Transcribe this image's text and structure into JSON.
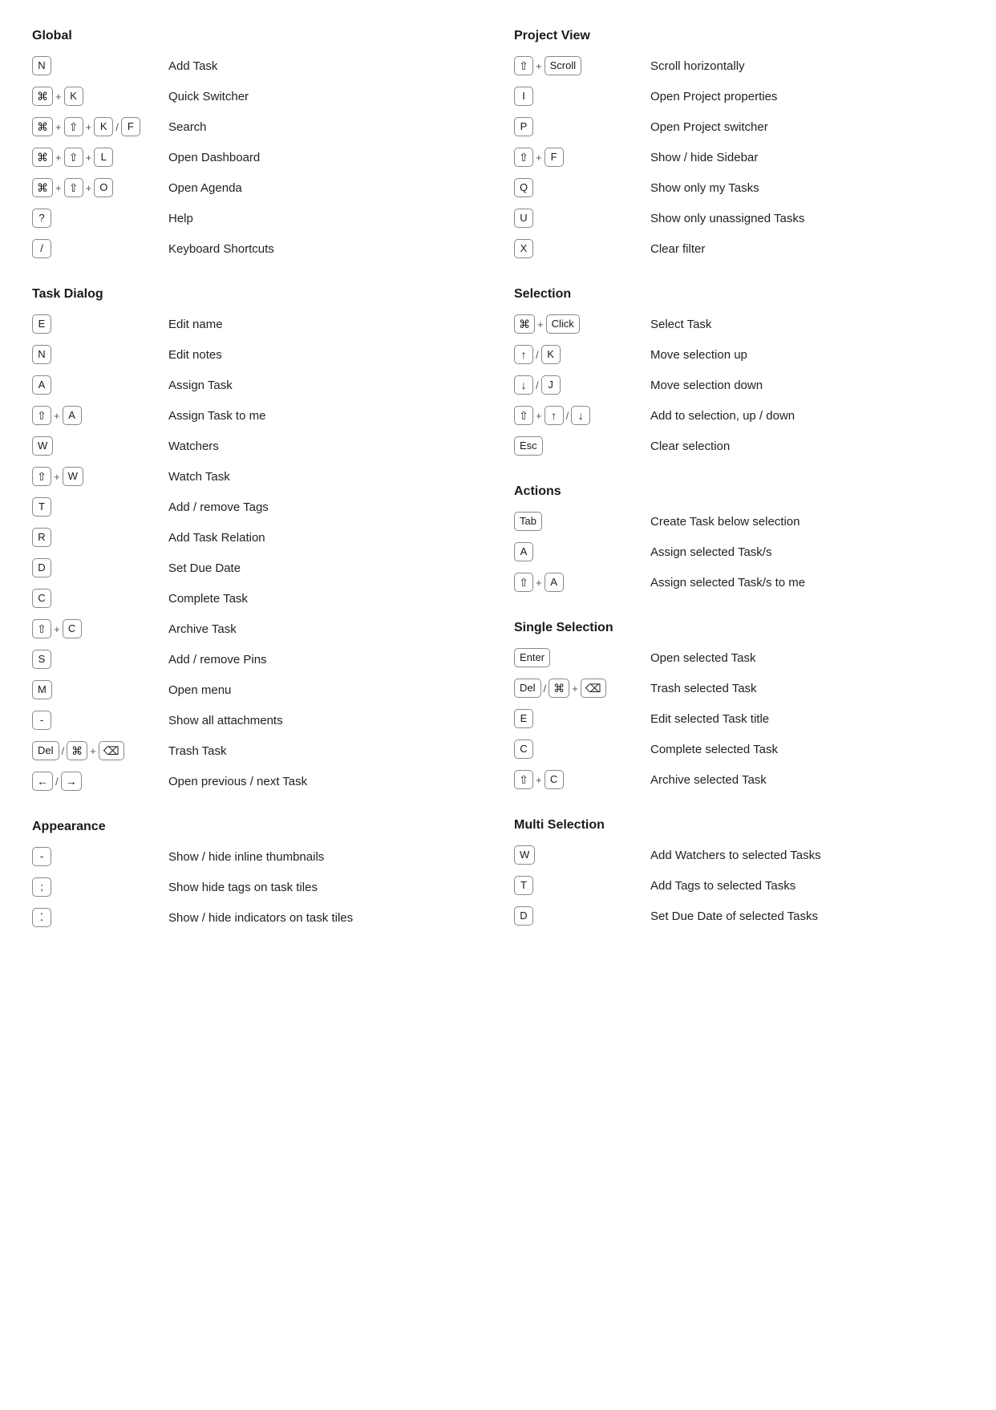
{
  "sections": {
    "global": {
      "title": "Global",
      "shortcuts": [
        {
          "keys": [
            {
              "k": "N",
              "type": "key"
            }
          ],
          "desc": "Add Task"
        },
        {
          "keys": [
            {
              "k": "⌘",
              "type": "key-sym"
            },
            {
              "k": "+",
              "type": "sep"
            },
            {
              "k": "K",
              "type": "key"
            }
          ],
          "desc": "Quick Switcher"
        },
        {
          "keys": [
            {
              "k": "⌘",
              "type": "key-sym"
            },
            {
              "k": "+",
              "type": "sep"
            },
            {
              "k": "⇧",
              "type": "key-sym"
            },
            {
              "k": "+",
              "type": "sep"
            },
            {
              "k": "K",
              "type": "key"
            },
            {
              "k": "/",
              "type": "sep"
            },
            {
              "k": "F",
              "type": "key"
            }
          ],
          "desc": "Search"
        },
        {
          "keys": [
            {
              "k": "⌘",
              "type": "key-sym"
            },
            {
              "k": "+",
              "type": "sep"
            },
            {
              "k": "⇧",
              "type": "key-sym"
            },
            {
              "k": "+",
              "type": "sep"
            },
            {
              "k": "L",
              "type": "key"
            }
          ],
          "desc": "Open Dashboard"
        },
        {
          "keys": [
            {
              "k": "⌘",
              "type": "key-sym"
            },
            {
              "k": "+",
              "type": "sep"
            },
            {
              "k": "⇧",
              "type": "key-sym"
            },
            {
              "k": "+",
              "type": "sep"
            },
            {
              "k": "O",
              "type": "key"
            }
          ],
          "desc": "Open Agenda"
        },
        {
          "keys": [
            {
              "k": "?",
              "type": "key"
            }
          ],
          "desc": "Help"
        },
        {
          "keys": [
            {
              "k": "/",
              "type": "key"
            }
          ],
          "desc": "Keyboard Shortcuts"
        }
      ]
    },
    "taskDialog": {
      "title": "Task Dialog",
      "shortcuts": [
        {
          "keys": [
            {
              "k": "E",
              "type": "key"
            }
          ],
          "desc": "Edit name"
        },
        {
          "keys": [
            {
              "k": "N",
              "type": "key"
            }
          ],
          "desc": "Edit notes"
        },
        {
          "keys": [
            {
              "k": "A",
              "type": "key"
            }
          ],
          "desc": "Assign Task"
        },
        {
          "keys": [
            {
              "k": "⇧",
              "type": "key-sym"
            },
            {
              "k": "+",
              "type": "sep"
            },
            {
              "k": "A",
              "type": "key"
            }
          ],
          "desc": "Assign Task to me"
        },
        {
          "keys": [
            {
              "k": "W",
              "type": "key"
            }
          ],
          "desc": "Watchers"
        },
        {
          "keys": [
            {
              "k": "⇧",
              "type": "key-sym"
            },
            {
              "k": "+",
              "type": "sep"
            },
            {
              "k": "W",
              "type": "key"
            }
          ],
          "desc": "Watch Task"
        },
        {
          "keys": [
            {
              "k": "T",
              "type": "key"
            }
          ],
          "desc": "Add / remove Tags"
        },
        {
          "keys": [
            {
              "k": "R",
              "type": "key"
            }
          ],
          "desc": "Add Task Relation"
        },
        {
          "keys": [
            {
              "k": "D",
              "type": "key"
            }
          ],
          "desc": "Set Due Date"
        },
        {
          "keys": [
            {
              "k": "C",
              "type": "key"
            }
          ],
          "desc": "Complete Task"
        },
        {
          "keys": [
            {
              "k": "⇧",
              "type": "key-sym"
            },
            {
              "k": "+",
              "type": "sep"
            },
            {
              "k": "C",
              "type": "key"
            }
          ],
          "desc": "Archive Task"
        },
        {
          "keys": [
            {
              "k": "S",
              "type": "key"
            }
          ],
          "desc": "Add / remove Pins"
        },
        {
          "keys": [
            {
              "k": "M",
              "type": "key"
            }
          ],
          "desc": "Open menu"
        },
        {
          "keys": [
            {
              "k": "-",
              "type": "key"
            }
          ],
          "desc": "Show all attachments"
        },
        {
          "keys": [
            {
              "k": "Del",
              "type": "key"
            },
            {
              "k": "/",
              "type": "sep"
            },
            {
              "k": "⌘",
              "type": "key-sym"
            },
            {
              "k": "+",
              "type": "sep"
            },
            {
              "k": "⌫",
              "type": "key-sym"
            }
          ],
          "desc": "Trash Task"
        },
        {
          "keys": [
            {
              "k": "←",
              "type": "key-sym"
            },
            {
              "k": "/",
              "type": "sep"
            },
            {
              "k": "→",
              "type": "key-sym"
            }
          ],
          "desc": "Open previous / next Task"
        }
      ]
    },
    "appearance": {
      "title": "Appearance",
      "shortcuts": [
        {
          "keys": [
            {
              "k": "-",
              "type": "key"
            }
          ],
          "desc": "Show / hide inline thumbnails"
        },
        {
          "keys": [
            {
              "k": ";",
              "type": "key"
            }
          ],
          "desc": "Show hide tags on task tiles"
        },
        {
          "keys": [
            {
              "k": "⁚",
              "type": "key"
            }
          ],
          "desc": "Show / hide indicators on task tiles"
        }
      ]
    },
    "projectView": {
      "title": "Project View",
      "shortcuts": [
        {
          "keys": [
            {
              "k": "⇧",
              "type": "key-sym"
            },
            {
              "k": "+",
              "type": "sep"
            },
            {
              "k": "Scroll",
              "type": "key"
            }
          ],
          "desc": "Scroll horizontally"
        },
        {
          "keys": [
            {
              "k": "I",
              "type": "key"
            }
          ],
          "desc": "Open Project properties"
        },
        {
          "keys": [
            {
              "k": "P",
              "type": "key"
            }
          ],
          "desc": "Open Project switcher"
        },
        {
          "keys": [
            {
              "k": "⇧",
              "type": "key-sym"
            },
            {
              "k": "+",
              "type": "sep"
            },
            {
              "k": "F",
              "type": "key"
            }
          ],
          "desc": "Show / hide Sidebar"
        },
        {
          "keys": [
            {
              "k": "Q",
              "type": "key"
            }
          ],
          "desc": "Show only my Tasks"
        },
        {
          "keys": [
            {
              "k": "U",
              "type": "key"
            }
          ],
          "desc": "Show only unassigned Tasks"
        },
        {
          "keys": [
            {
              "k": "X",
              "type": "key"
            }
          ],
          "desc": "Clear filter"
        }
      ]
    },
    "selection": {
      "title": "Selection",
      "shortcuts": [
        {
          "keys": [
            {
              "k": "⌘",
              "type": "key-sym"
            },
            {
              "k": "+",
              "type": "sep"
            },
            {
              "k": "Click",
              "type": "key"
            }
          ],
          "desc": "Select Task"
        },
        {
          "keys": [
            {
              "k": "↑",
              "type": "key-sym"
            },
            {
              "k": "/",
              "type": "sep"
            },
            {
              "k": "K",
              "type": "key"
            }
          ],
          "desc": "Move selection up"
        },
        {
          "keys": [
            {
              "k": "↓",
              "type": "key-sym"
            },
            {
              "k": "/",
              "type": "sep"
            },
            {
              "k": "J",
              "type": "key"
            }
          ],
          "desc": "Move selection down"
        },
        {
          "keys": [
            {
              "k": "⇧",
              "type": "key-sym"
            },
            {
              "k": "+",
              "type": "sep"
            },
            {
              "k": "↑",
              "type": "key-sym"
            },
            {
              "k": "/",
              "type": "sep"
            },
            {
              "k": "↓",
              "type": "key-sym"
            }
          ],
          "desc": "Add to selection, up / down"
        },
        {
          "keys": [
            {
              "k": "Esc",
              "type": "key"
            }
          ],
          "desc": "Clear selection"
        }
      ]
    },
    "actions": {
      "title": "Actions",
      "shortcuts": [
        {
          "keys": [
            {
              "k": "Tab",
              "type": "key"
            }
          ],
          "desc": "Create Task below selection"
        },
        {
          "keys": [
            {
              "k": "A",
              "type": "key"
            }
          ],
          "desc": "Assign selected Task/s"
        },
        {
          "keys": [
            {
              "k": "⇧",
              "type": "key-sym"
            },
            {
              "k": "+",
              "type": "sep"
            },
            {
              "k": "A",
              "type": "key"
            }
          ],
          "desc": "Assign selected Task/s to me"
        }
      ]
    },
    "singleSelection": {
      "title": "Single Selection",
      "shortcuts": [
        {
          "keys": [
            {
              "k": "Enter",
              "type": "key"
            }
          ],
          "desc": "Open selected Task"
        },
        {
          "keys": [
            {
              "k": "Del",
              "type": "key"
            },
            {
              "k": "/",
              "type": "sep"
            },
            {
              "k": "⌘",
              "type": "key-sym"
            },
            {
              "k": "+",
              "type": "sep"
            },
            {
              "k": "⌫",
              "type": "key-sym"
            }
          ],
          "desc": "Trash selected Task"
        },
        {
          "keys": [
            {
              "k": "E",
              "type": "key"
            }
          ],
          "desc": "Edit selected Task title"
        },
        {
          "keys": [
            {
              "k": "C",
              "type": "key"
            }
          ],
          "desc": "Complete selected Task"
        },
        {
          "keys": [
            {
              "k": "⇧",
              "type": "key-sym"
            },
            {
              "k": "+",
              "type": "sep"
            },
            {
              "k": "C",
              "type": "key"
            }
          ],
          "desc": "Archive selected Task"
        }
      ]
    },
    "multiSelection": {
      "title": "Multi Selection",
      "shortcuts": [
        {
          "keys": [
            {
              "k": "W",
              "type": "key"
            }
          ],
          "desc": "Add Watchers to selected Tasks"
        },
        {
          "keys": [
            {
              "k": "T",
              "type": "key"
            }
          ],
          "desc": "Add Tags to selected Tasks"
        },
        {
          "keys": [
            {
              "k": "D",
              "type": "key"
            }
          ],
          "desc": "Set Due Date of selected Tasks"
        }
      ]
    }
  }
}
